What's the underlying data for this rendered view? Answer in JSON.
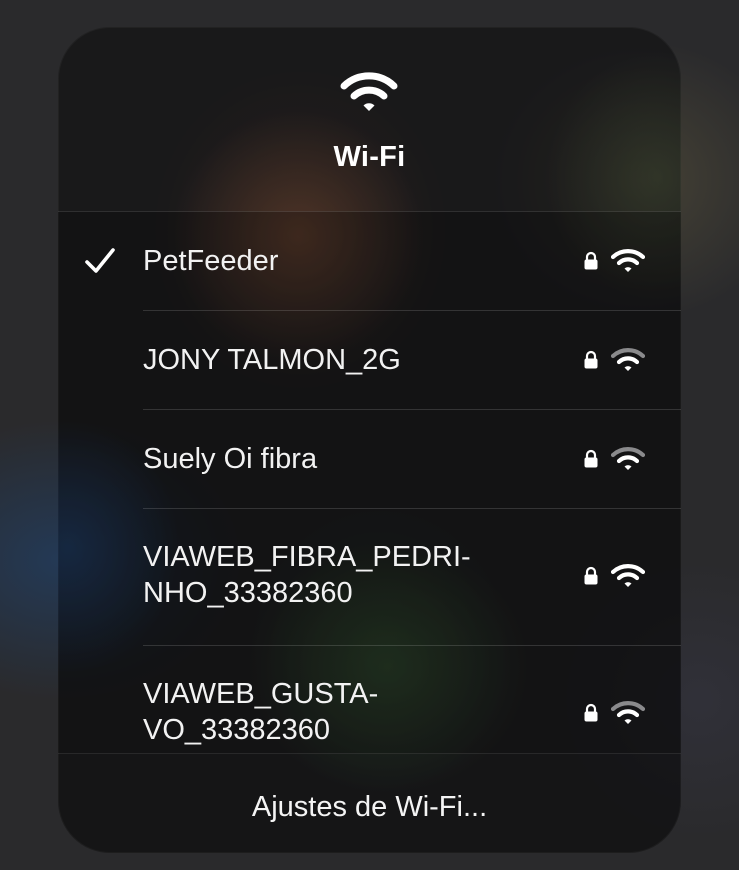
{
  "header": {
    "icon": "wifi-icon",
    "title": "Wi-Fi"
  },
  "networks": [
    {
      "name": "PetFeeder",
      "selected": true,
      "secured": true,
      "signal_bars": 3
    },
    {
      "name": "JONY TALMON_2G",
      "selected": false,
      "secured": true,
      "signal_bars": 2
    },
    {
      "name": "Suely Oi fibra",
      "selected": false,
      "secured": true,
      "signal_bars": 2
    },
    {
      "name_line1": "VIAWEB_FIBRA_PEDRI-",
      "name_line2": "NHO_33382360",
      "selected": false,
      "secured": true,
      "signal_bars": 3
    },
    {
      "name_line1": "VIAWEB_GUSTA-",
      "name_line2": "VO_33382360",
      "selected": false,
      "secured": true,
      "signal_bars": 2
    }
  ],
  "footer": {
    "settings_label": "Ajustes de Wi-Fi..."
  },
  "colors": {
    "text": "#ffffff",
    "dim_signal": "#8a8a8c"
  }
}
